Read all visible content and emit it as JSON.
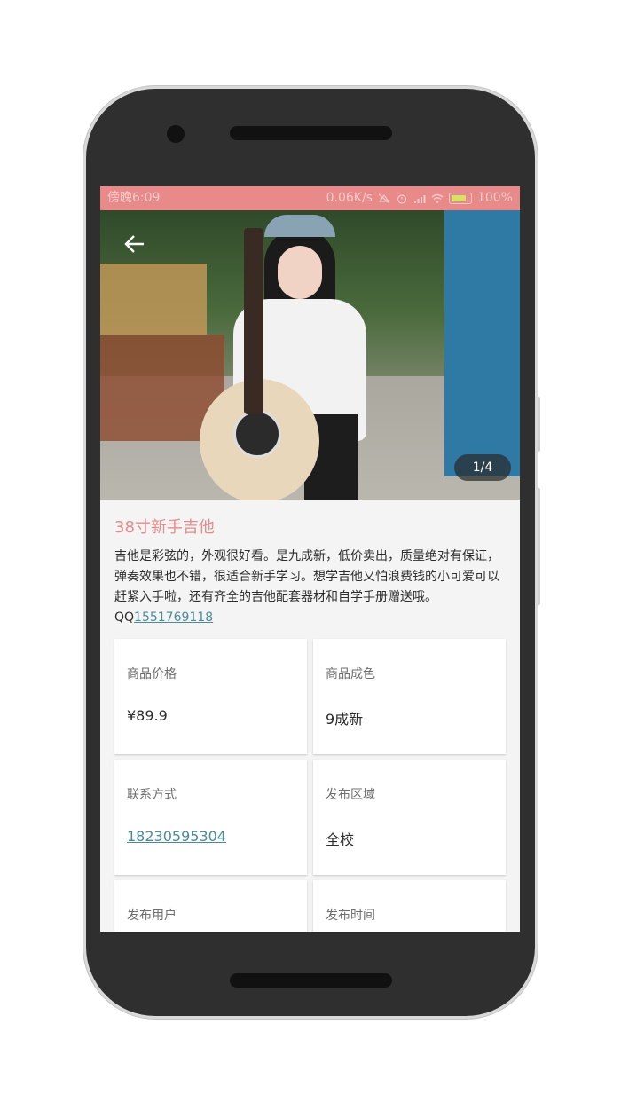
{
  "status_bar": {
    "time": "傍晚6:09",
    "network_speed": "0.06K/s",
    "battery": "100%"
  },
  "gallery": {
    "indicator": "1/4"
  },
  "item": {
    "title": "38寸新手吉他",
    "description": "吉他是彩弦的，外观很好看。是九成新，低价卖出，质量绝对有保证，弹奏效果也不错，很适合新手学习。想学吉他又怕浪费钱的小可爱可以赶紧入手啦，还有齐全的吉他配套器材和自学手册赠送哦。QQ",
    "qq": "1551769118"
  },
  "details": [
    {
      "label": "商品价格",
      "value": "¥89.9"
    },
    {
      "label": "商品成色",
      "value": "9成新"
    },
    {
      "label": "联系方式",
      "value": "18230595304"
    },
    {
      "label": "发布区域",
      "value": "全校"
    },
    {
      "label": "发布用户",
      "value": ""
    },
    {
      "label": "发布时间",
      "value": ""
    }
  ],
  "colors": {
    "accent": "#e88a8a",
    "link": "#4a8a9a"
  },
  "icons": {
    "back": "back-arrow-icon",
    "clock": "alarm-icon",
    "wifi": "wifi-icon",
    "signal": "signal-icon"
  }
}
